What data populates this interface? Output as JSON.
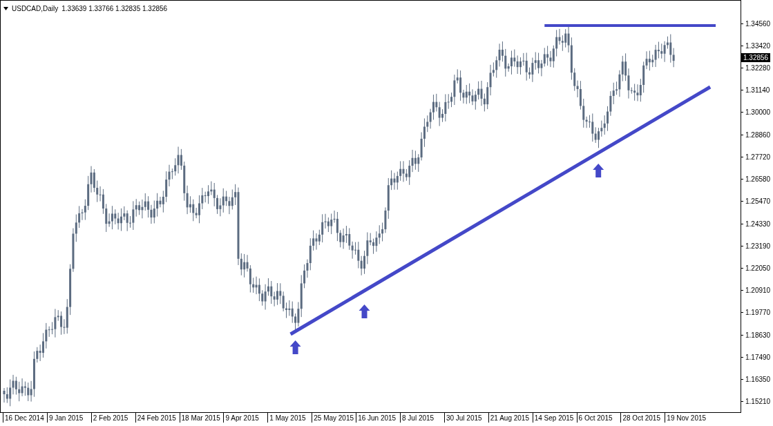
{
  "chart_header": {
    "symbol": "USDCAD,Daily",
    "ohlc": "1.33639 1.33766 1.32835 1.32856"
  },
  "price_axis": [
    "1.34560",
    "1.33420",
    "1.32280",
    "1.31140",
    "1.30000",
    "1.28860",
    "1.27720",
    "1.26580",
    "1.25470",
    "1.24330",
    "1.23190",
    "1.22050",
    "1.20910",
    "1.19770",
    "1.18630",
    "1.17490",
    "1.16350",
    "1.15210"
  ],
  "current_price": "1.32856",
  "time_axis": [
    "16 Dec 2014",
    "9 Jan 2015",
    "2 Feb 2015",
    "24 Feb 2015",
    "18 Mar 2015",
    "9 Apr 2015",
    "1 May 2015",
    "25 May 2015",
    "16 Jun 2015",
    "8 Jul 2015",
    "30 Jul 2015",
    "21 Aug 2015",
    "14 Sep 2015",
    "6 Oct 2015",
    "28 Oct 2015",
    "19 Nov 2015"
  ]
}
